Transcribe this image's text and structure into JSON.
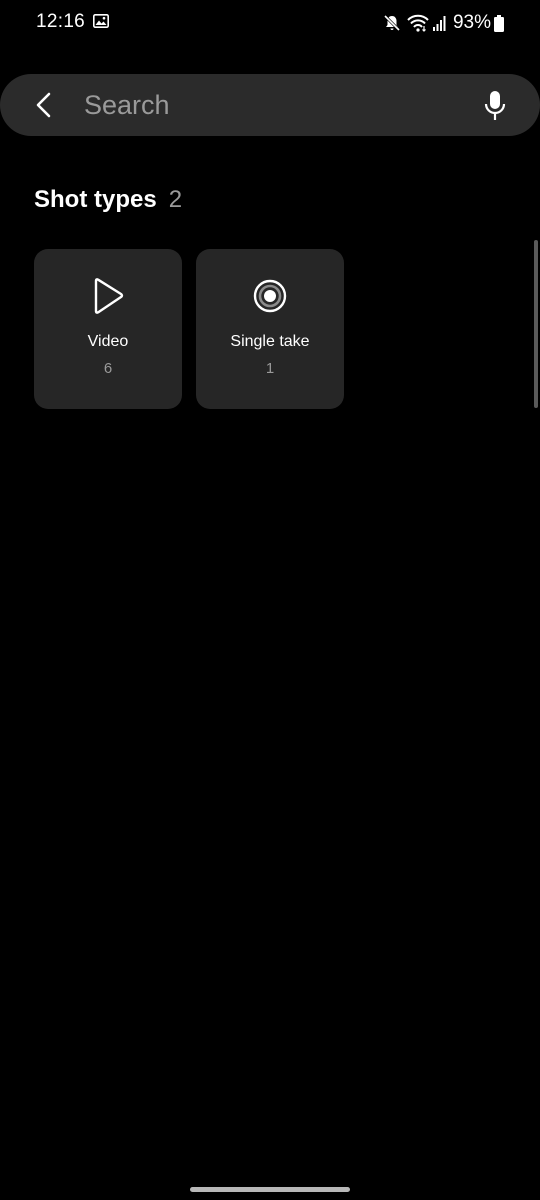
{
  "status_bar": {
    "time": "12:16",
    "battery_percent": "93%",
    "icons": [
      "gallery-icon",
      "mute-icon",
      "wifi-icon",
      "signal-icon",
      "battery-icon"
    ]
  },
  "search": {
    "placeholder": "Search",
    "value": ""
  },
  "section": {
    "title": "Shot types",
    "count": "2"
  },
  "tiles": [
    {
      "label": "Video",
      "count": "6",
      "icon": "play-icon"
    },
    {
      "label": "Single take",
      "count": "1",
      "icon": "single-take-icon"
    }
  ],
  "colors": {
    "background": "#000000",
    "search_bar": "#2b2b2b",
    "tile": "#262626",
    "secondary_text": "#9a9a9a"
  }
}
